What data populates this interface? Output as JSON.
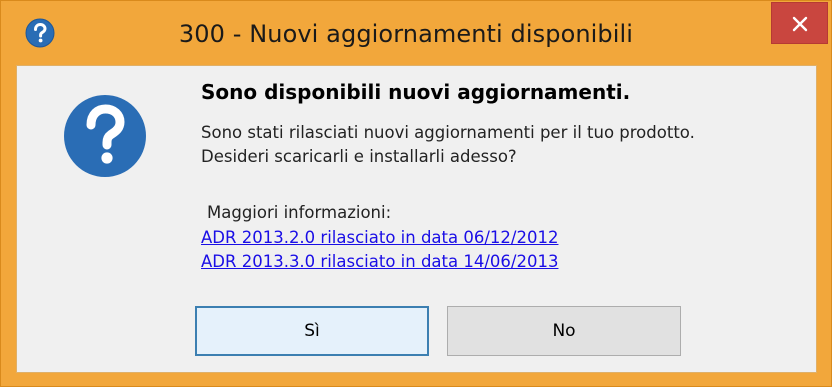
{
  "window": {
    "title": "300 - Nuovi aggiornamenti disponibili",
    "close_label": "✕",
    "title_icon": "question-icon",
    "frame_color": "#f2a73b",
    "close_color": "#c9463f"
  },
  "dialog": {
    "icon": "question-icon",
    "icon_color": "#2a6db5",
    "heading": "Sono disponibili nuovi aggiornamenti.",
    "body_line1": "Sono stati rilasciati nuovi aggiornamenti per il tuo prodotto.",
    "body_line2": "Desideri scaricarli e installarli adesso?",
    "more_info_label": "Maggiori informazioni:",
    "links": [
      "ADR 2013.2.0 rilasciato in data 06/12/2012",
      "ADR 2013.3.0 rilasciato in data 14/06/2013"
    ],
    "link_color": "#1a0ee6"
  },
  "buttons": {
    "yes_label": "Sì",
    "no_label": "No"
  }
}
